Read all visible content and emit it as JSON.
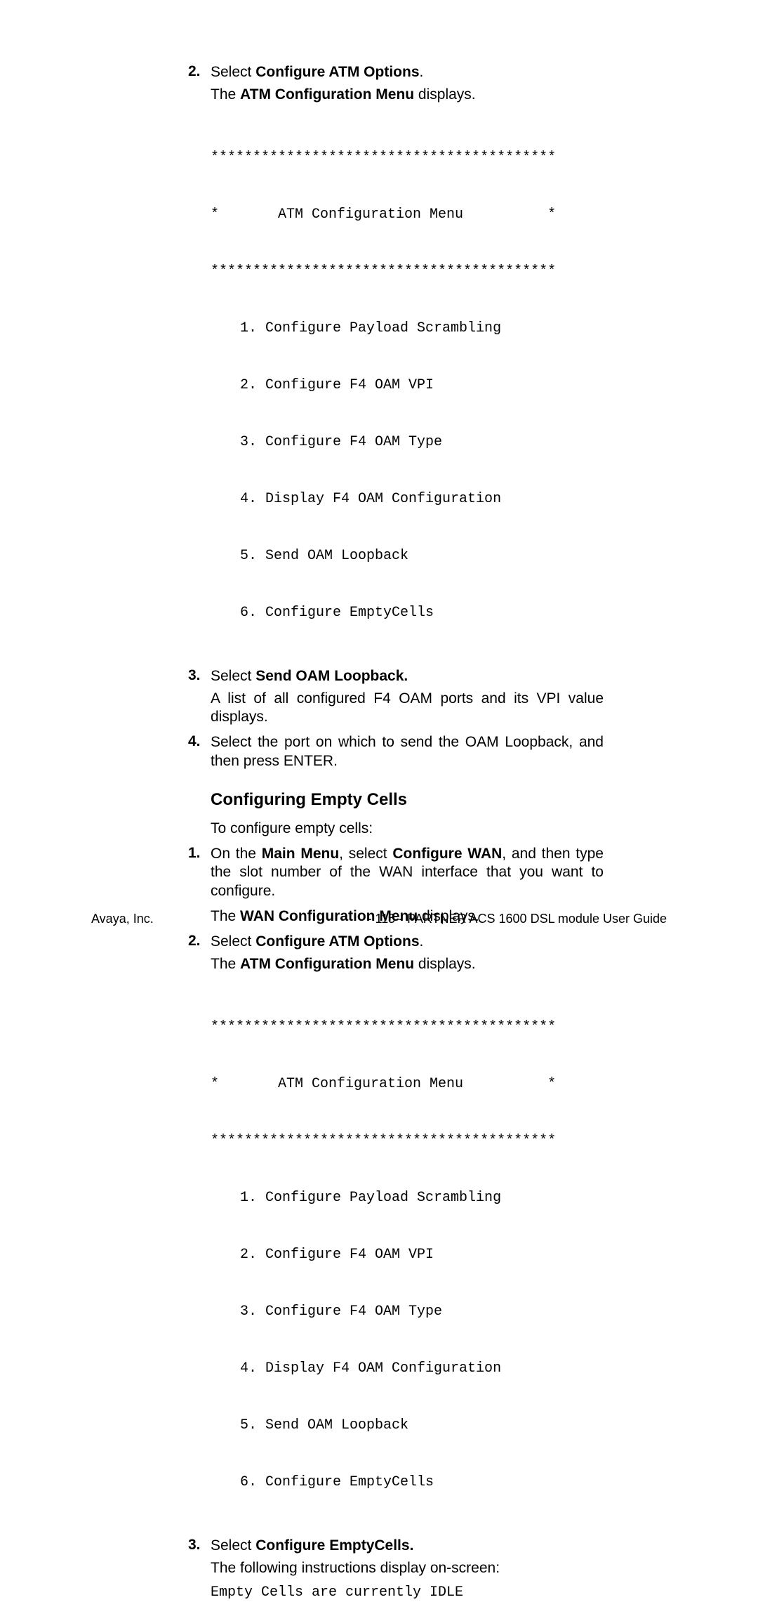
{
  "step2a_num": "2.",
  "step2a_select": "Select ",
  "step2a_bold": "Configure ATM Options",
  "step2a_period": ".",
  "step2a_sub1_the": "The ",
  "step2a_sub1_bold": "ATM Configuration Menu",
  "step2a_sub1_rest": " displays.",
  "menu1_stars1": "*****************************************",
  "menu1_title": "*       ATM Configuration Menu          *",
  "menu1_stars2": "*****************************************",
  "menu1_i1": "  1. Configure Payload Scrambling",
  "menu1_i2": "  2. Configure F4 OAM VPI",
  "menu1_i3": "  3. Configure F4 OAM Type",
  "menu1_i4": "  4. Display F4 OAM Configuration",
  "menu1_i5": "  5. Send OAM Loopback",
  "menu1_i6": "  6. Configure EmptyCells",
  "step3a_num": "3.",
  "step3a_select": "Select ",
  "step3a_bold": "Send OAM Loopback.",
  "step3a_sub": "A list of all configured F4 OAM ports and its VPI value displays.",
  "step4a_num": "4.",
  "step4a_text": "Select the port on which to send the OAM Loopback, and then press ENTER.",
  "h2": "Configuring Empty Cells",
  "intro": "To configure empty cells:",
  "step1b_num": "1.",
  "step1b_p1": "On the ",
  "step1b_b1": "Main Menu",
  "step1b_p2": ", select ",
  "step1b_b2": "Configure WAN",
  "step1b_p3": ", and then type the slot number of the WAN interface that you want to configure.",
  "step1b_sub_the": "The ",
  "step1b_sub_bold": "WAN Configuration Menu",
  "step1b_sub_rest": " displays.",
  "step2b_num": "2.",
  "step2b_select": "Select ",
  "step2b_bold": "Configure ATM Options",
  "step2b_period": ".",
  "step2b_sub_the": "The ",
  "step2b_sub_bold": "ATM Configuration Menu",
  "step2b_sub_rest": " displays.",
  "menu2_stars1": "*****************************************",
  "menu2_title": "*       ATM Configuration Menu          *",
  "menu2_stars2": "*****************************************",
  "menu2_i1": "  1. Configure Payload Scrambling",
  "menu2_i2": "  2. Configure F4 OAM VPI",
  "menu2_i3": "  3. Configure F4 OAM Type",
  "menu2_i4": "  4. Display F4 OAM Configuration",
  "menu2_i5": "  5. Send OAM Loopback",
  "menu2_i6": "  6. Configure EmptyCells",
  "step3b_num": "3.",
  "step3b_select": "Select ",
  "step3b_bold": "Configure EmptyCells.",
  "step3b_sub": "The following instructions display on-screen:",
  "step3b_mono": "Empty Cells are currently IDLE",
  "footer_left": "Avaya, Inc.",
  "footer_page": "- 115 -",
  "footer_right": "PARTNER ACS 1600 DSL module User Guide"
}
